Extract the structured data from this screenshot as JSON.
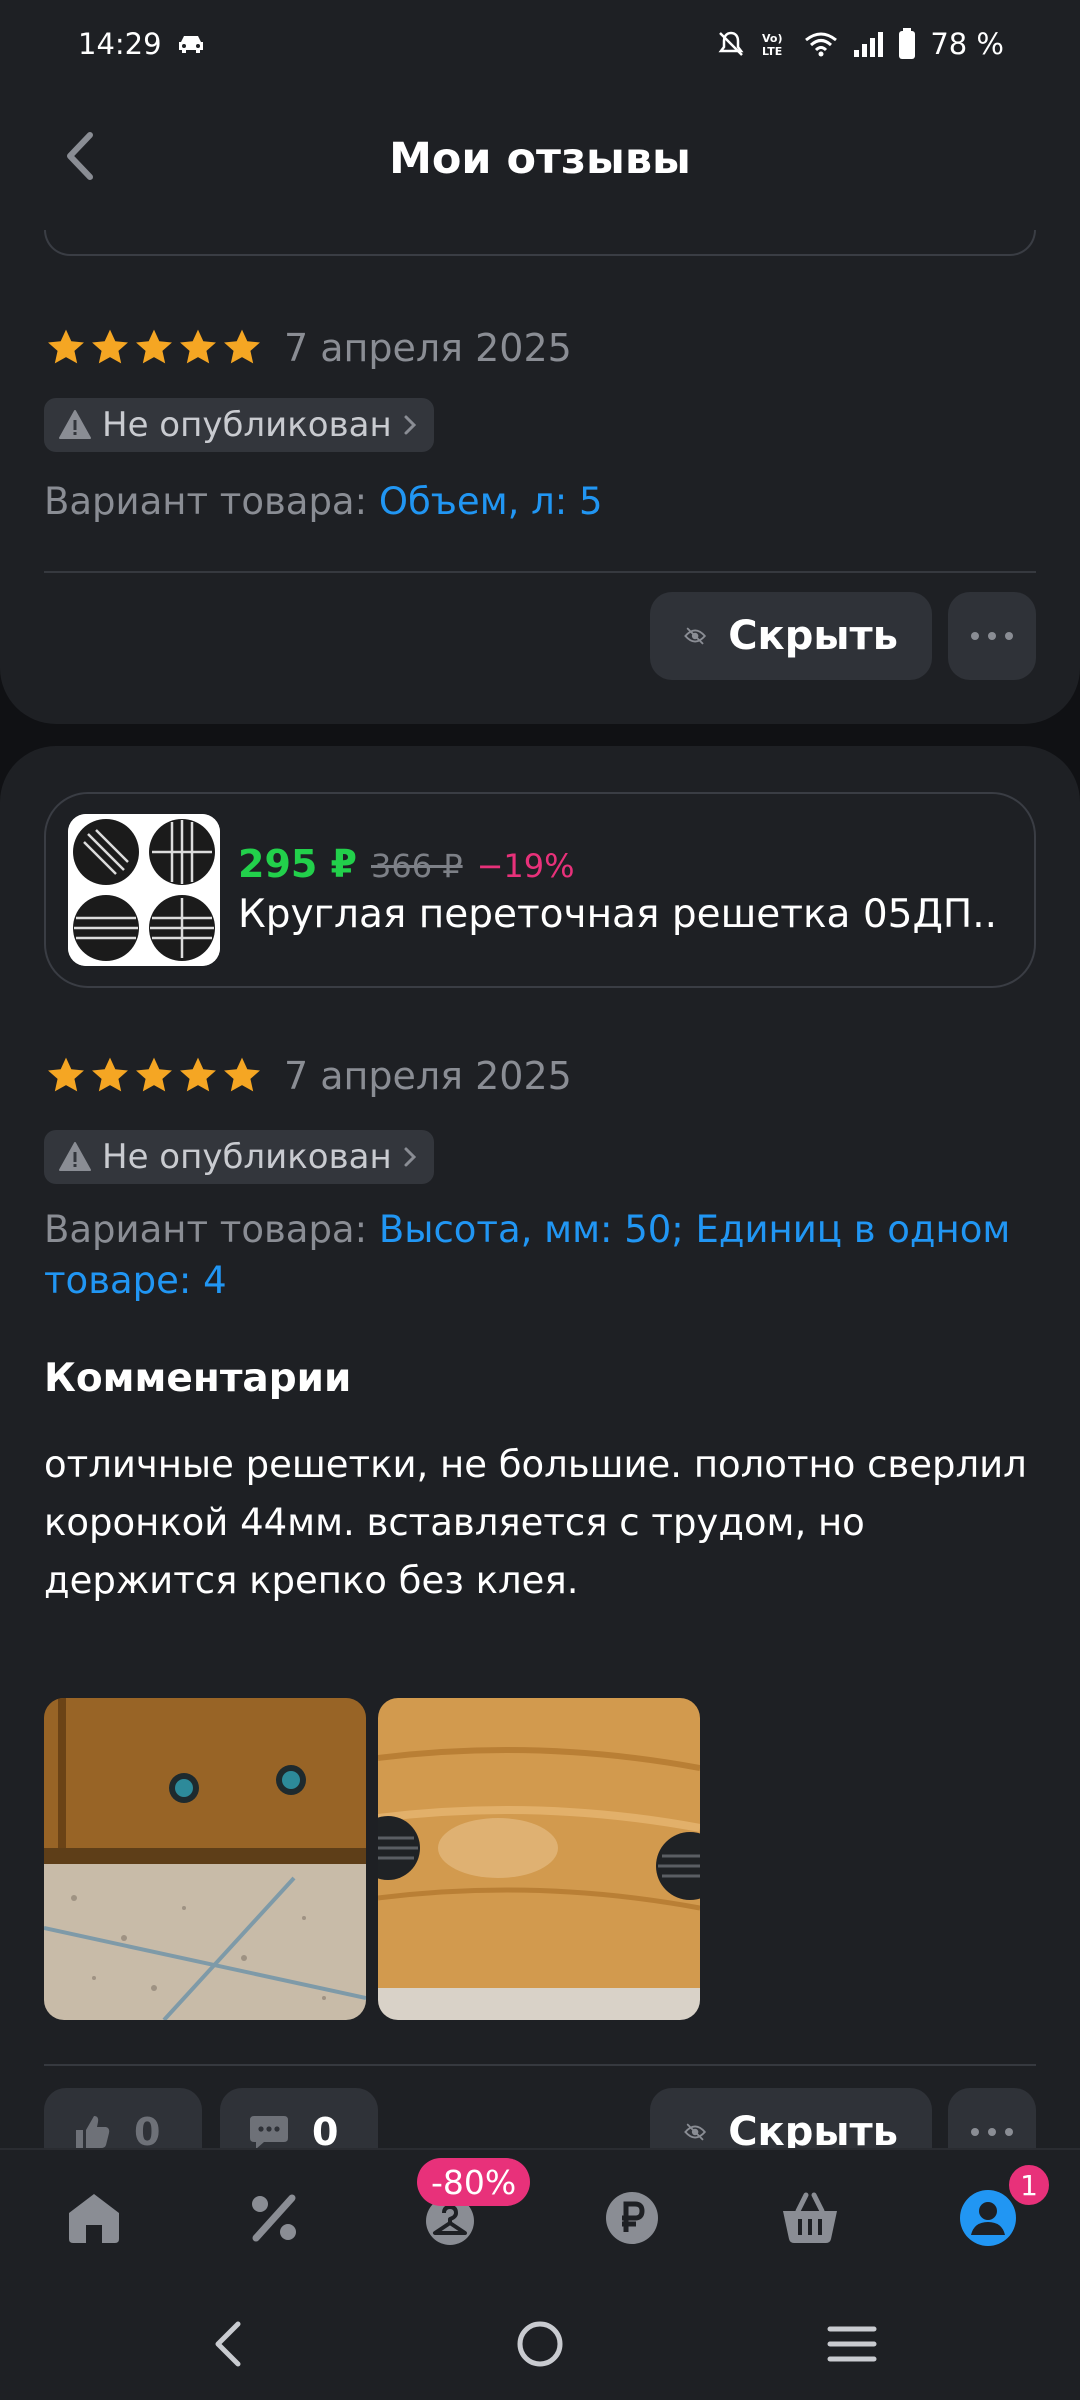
{
  "status_bar": {
    "time": "14:29",
    "battery_text": "78 %",
    "icons": [
      "car-icon",
      "mute-icon",
      "volte-icon",
      "wifi-icon",
      "signal-icon",
      "battery-icon"
    ]
  },
  "header": {
    "title": "Мои отзывы",
    "back_icon": "chevron-left-icon"
  },
  "reviews": [
    {
      "rating": 5,
      "date": "7 апреля 2025",
      "status": "Не опубликован",
      "variant_label": "Вариант товара:",
      "variant_value": "Объем, л: 5",
      "hide_label": "Скрыть"
    },
    {
      "product": {
        "price": "295 ₽",
        "old_price": "366 ₽",
        "discount": "−19%",
        "name": "Круглая переточная решетка 05ДП..."
      },
      "rating": 5,
      "date": "7 апреля 2025",
      "status": "Не опубликован",
      "variant_label": "Вариант товара:",
      "variant_value": "Высота, мм: 50; Единиц в одном товаре: 4",
      "comments_title": "Комментарии",
      "comment": "отличные решетки, не большие. полотно сверлил коронкой 44мм. вставляется с трудом, но держится крепко без клея.",
      "likes": "0",
      "comments_count": "0",
      "hide_label": "Скрыть"
    }
  ],
  "bottom_nav": {
    "items": [
      "home-icon",
      "percent-icon",
      "hanger-icon",
      "ruble-icon",
      "basket-icon",
      "profile-icon"
    ],
    "promo_badge": "-80%",
    "profile_badge": "1"
  },
  "colors": {
    "background": "#101114",
    "card": "#1e2024",
    "accent_blue": "#2196f3",
    "price_green": "#22d04b",
    "discount_pink": "#e8317a",
    "star": "#f5a623"
  }
}
